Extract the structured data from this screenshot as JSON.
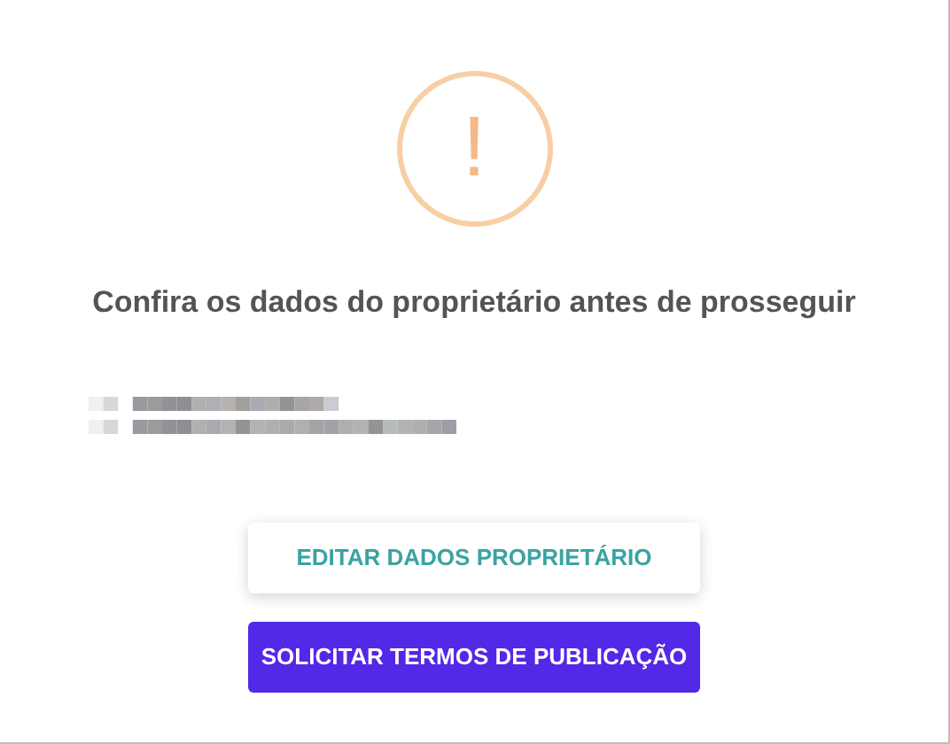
{
  "dialog": {
    "icon": {
      "kind": "warning",
      "symbol": "!"
    },
    "title": "Confira os dados do proprietário antes de prosseguir",
    "buttons": [
      {
        "label": "EDITAR DADOS PROPRIETÁRIO",
        "kind": "secondary"
      },
      {
        "label": "SOLICITAR TERMOS DE PUBLICAÇÃO",
        "kind": "primary"
      }
    ]
  }
}
